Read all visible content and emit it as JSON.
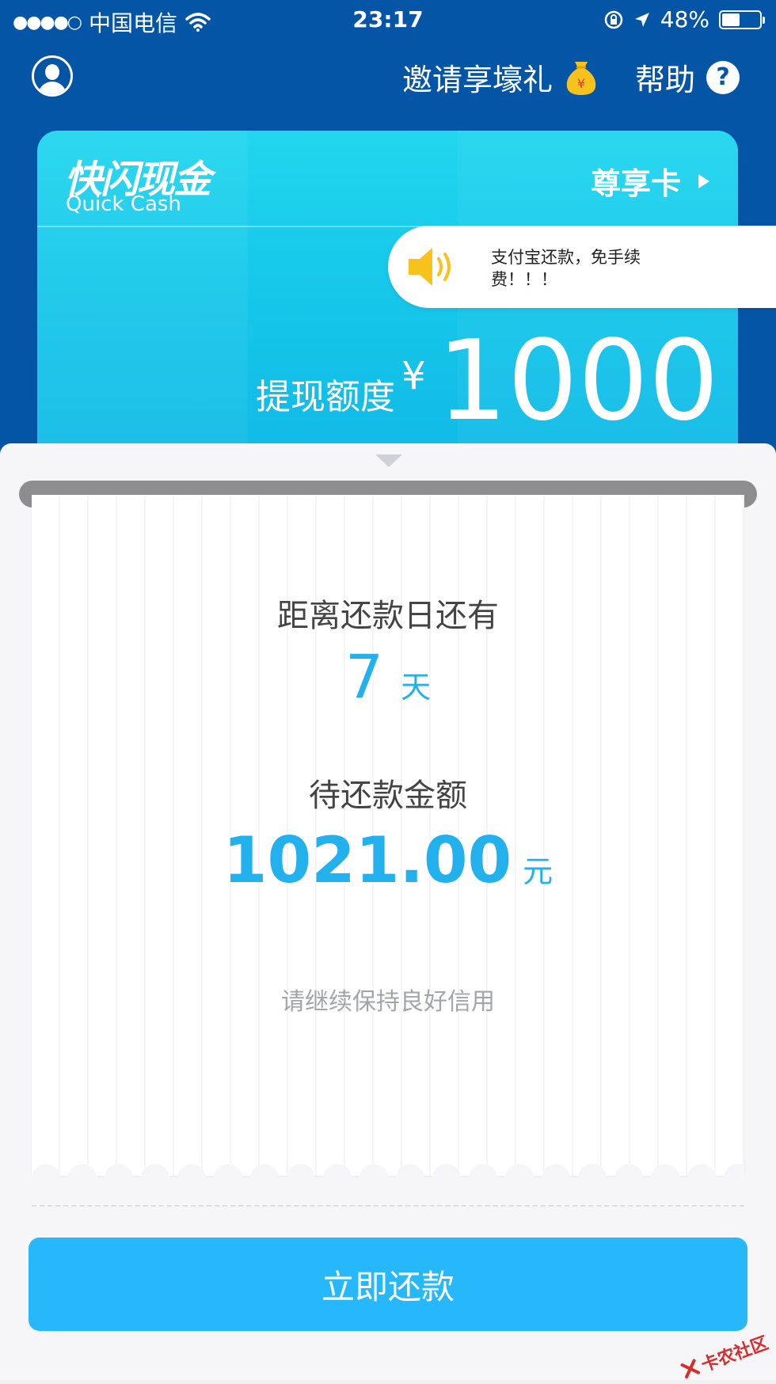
{
  "status_bar": {
    "carrier": "中国电信",
    "time": "23:17",
    "battery": "48%",
    "battery_level": 0.48
  },
  "header": {
    "invite_label": "邀请享壕礼",
    "help_label": "帮助",
    "help_icon_glyph": "?"
  },
  "card": {
    "brand_cn": "快闪现金",
    "brand_en": "Quick Cash",
    "premium_label": "尊享卡",
    "limit_label": "提现额度",
    "currency": "¥",
    "limit_value": "1000"
  },
  "notice": {
    "text": "支付宝还款，免手续费！！！"
  },
  "repayment": {
    "countdown_label": "距离还款日还有",
    "days": "7",
    "days_unit": "天",
    "due_label": "待还款金额",
    "due_amount": "1021.00",
    "amount_unit": "元",
    "credit_note": "请继续保持良好信用"
  },
  "actions": {
    "repay_button": "立即还款"
  },
  "watermark": {
    "text": "卡农社区"
  },
  "colors": {
    "header_blue": "#0455a6",
    "card_cyan": "#1ccbea",
    "accent_blue": "#23b1ee",
    "button_blue": "#26b8fa"
  }
}
